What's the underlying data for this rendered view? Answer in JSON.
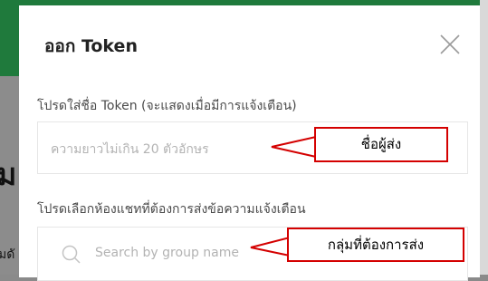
{
  "background": {
    "heading_fragment": "ม",
    "text_fragment": "มดั"
  },
  "modal": {
    "title": "ออก Token",
    "close_icon": "close-icon",
    "token_name": {
      "label": "โปรดใส่ชื่อ Token (จะแสดงเมื่อมีการแจ้งเตือน)",
      "placeholder": "ความยาวไม่เกิน 20 ตัวอักษร"
    },
    "chat_select": {
      "label": "โปรดเลือกห้องแชทที่ต้องการส่งข้อความแจ้งเตือน",
      "placeholder": "Search by group name",
      "icon": "search-icon"
    }
  },
  "annotations": {
    "sender_name": "ชื่อผู้ส่ง",
    "send_group": "กลุ่มที่ต้องการส่ง"
  },
  "colors": {
    "header_green": "#1f7a3c",
    "annotation_red": "#d40000",
    "placeholder": "#b3b3b3"
  }
}
